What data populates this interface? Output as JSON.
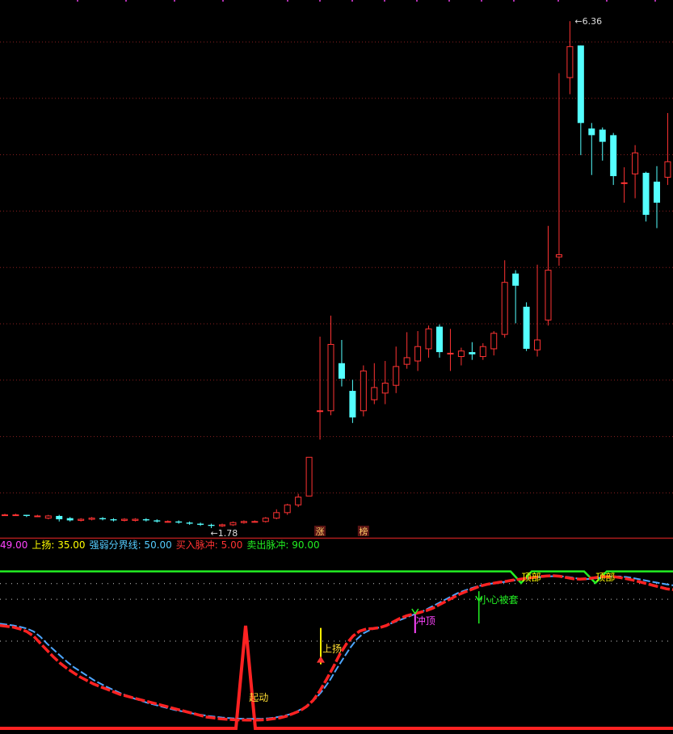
{
  "price_panel": {
    "high_label": "6.36",
    "low_label": "1.78",
    "markers": [
      {
        "text": "涨",
        "bar": 29
      },
      {
        "text": "榜",
        "bar": 33
      }
    ],
    "candles": [
      [
        1.9,
        1.9,
        1.91,
        1.89
      ],
      [
        1.9,
        1.9,
        1.91,
        1.89
      ],
      [
        1.9,
        1.89,
        1.9,
        1.88
      ],
      [
        1.89,
        1.89,
        1.9,
        1.88
      ],
      [
        1.87,
        1.89,
        1.9,
        1.86
      ],
      [
        1.89,
        1.86,
        1.9,
        1.84
      ],
      [
        1.87,
        1.85,
        1.88,
        1.84
      ],
      [
        1.85,
        1.86,
        1.87,
        1.84
      ],
      [
        1.86,
        1.87,
        1.88,
        1.85
      ],
      [
        1.87,
        1.86,
        1.88,
        1.85
      ],
      [
        1.86,
        1.85,
        1.87,
        1.84
      ],
      [
        1.85,
        1.86,
        1.87,
        1.84
      ],
      [
        1.85,
        1.86,
        1.87,
        1.84
      ],
      [
        1.86,
        1.85,
        1.87,
        1.84
      ],
      [
        1.85,
        1.84,
        1.86,
        1.83
      ],
      [
        1.84,
        1.84,
        1.85,
        1.83
      ],
      [
        1.84,
        1.83,
        1.85,
        1.82
      ],
      [
        1.83,
        1.82,
        1.84,
        1.81
      ],
      [
        1.82,
        1.81,
        1.83,
        1.8
      ],
      [
        1.81,
        1.8,
        1.82,
        1.78
      ],
      [
        1.8,
        1.81,
        1.82,
        1.79
      ],
      [
        1.81,
        1.83,
        1.84,
        1.8
      ],
      [
        1.83,
        1.84,
        1.85,
        1.82
      ],
      [
        1.84,
        1.84,
        1.85,
        1.83
      ],
      [
        1.84,
        1.87,
        1.88,
        1.83
      ],
      [
        1.87,
        1.92,
        1.95,
        1.86
      ],
      [
        1.92,
        1.99,
        2.0,
        1.9
      ],
      [
        1.99,
        2.06,
        2.09,
        1.97
      ],
      [
        2.07,
        2.42,
        2.42,
        2.07
      ],
      [
        2.84,
        2.84,
        3.51,
        2.58
      ],
      [
        2.84,
        3.44,
        3.7,
        2.8
      ],
      [
        3.27,
        3.13,
        3.48,
        3.06
      ],
      [
        3.02,
        2.78,
        3.12,
        2.73
      ],
      [
        2.84,
        3.2,
        3.25,
        2.79
      ],
      [
        2.94,
        3.05,
        3.27,
        2.9
      ],
      [
        3.0,
        3.09,
        3.29,
        2.9
      ],
      [
        3.07,
        3.24,
        3.42,
        3.0
      ],
      [
        3.26,
        3.32,
        3.55,
        3.22
      ],
      [
        3.29,
        3.42,
        3.56,
        3.2
      ],
      [
        3.4,
        3.58,
        3.61,
        3.32
      ],
      [
        3.6,
        3.37,
        3.62,
        3.32
      ],
      [
        3.36,
        3.36,
        3.58,
        3.2
      ],
      [
        3.33,
        3.38,
        3.41,
        3.25
      ],
      [
        3.37,
        3.35,
        3.46,
        3.3
      ],
      [
        3.33,
        3.42,
        3.45,
        3.3
      ],
      [
        3.4,
        3.54,
        3.56,
        3.34
      ],
      [
        3.53,
        4.0,
        4.2,
        3.5
      ],
      [
        4.08,
        3.97,
        4.11,
        3.63
      ],
      [
        3.78,
        3.4,
        3.82,
        3.38
      ],
      [
        3.39,
        3.48,
        4.16,
        3.33
      ],
      [
        3.66,
        4.11,
        4.51,
        3.61
      ],
      [
        4.23,
        4.25,
        5.89,
        4.15
      ],
      [
        5.85,
        6.13,
        6.36,
        5.7
      ],
      [
        6.14,
        5.44,
        6.14,
        5.15
      ],
      [
        5.39,
        5.33,
        5.44,
        4.97
      ],
      [
        5.38,
        5.27,
        5.4,
        5.1
      ],
      [
        5.33,
        4.96,
        5.35,
        4.88
      ],
      [
        4.9,
        4.9,
        5.04,
        4.72
      ],
      [
        4.98,
        5.17,
        5.24,
        4.76
      ],
      [
        4.99,
        4.61,
        5.0,
        4.55
      ],
      [
        4.91,
        4.72,
        5.05,
        4.49
      ],
      [
        4.95,
        5.09,
        5.53,
        4.88
      ]
    ]
  },
  "indicator_panel": {
    "legend": [
      {
        "text": "49.00",
        "color": "#ff44ff"
      },
      {
        "text": "上扬: 35.00",
        "color": "#ffff00"
      },
      {
        "text": "强弱分界线: 50.00",
        "color": "#55ccff"
      },
      {
        "text": "买入脉冲: 5.00",
        "color": "#ff3333"
      },
      {
        "text": "卖出脉冲: 90.00",
        "color": "#22ee22"
      }
    ],
    "ylim": [
      0,
      100
    ],
    "sell_line_value": 90,
    "dotted_lines": [
      50,
      74,
      83
    ],
    "red_line": [
      59,
      58.5,
      58,
      57,
      55.5,
      53,
      49,
      45,
      41,
      37.5,
      34.5,
      32,
      29.5,
      27.5,
      25.5,
      24,
      22.5,
      21,
      19.5,
      18.5,
      17.5,
      16.5,
      15.5,
      14.5,
      13.5,
      12.5,
      11.5,
      10.5,
      9.5,
      8.5,
      7.5,
      6.5,
      6,
      5.5,
      5.2,
      5,
      4.8,
      4.7,
      4.7,
      4.8,
      5,
      5.5,
      6,
      7,
      8.5,
      10,
      12.5,
      16,
      21.5,
      28,
      35,
      42.5,
      48.5,
      53,
      55.8,
      57,
      57.2,
      57.8,
      59,
      61,
      63,
      64.5,
      65.5,
      66.5,
      67.5,
      69,
      71,
      73,
      75,
      77,
      78.5,
      80,
      81.5,
      82.5,
      83.2,
      83.8,
      84.3,
      85,
      85.5,
      86,
      86.5,
      87,
      87.3,
      87.5,
      87.2,
      86.5,
      85.8,
      85.5,
      85.8,
      86.2,
      86.8,
      87,
      87,
      86.5,
      85.8,
      85,
      84,
      83,
      82,
      81,
      80,
      79.5
    ],
    "blue_line": [
      60,
      59.5,
      59,
      58.2,
      57.2,
      55.5,
      52.5,
      48.5,
      45,
      41.5,
      38,
      35,
      32.5,
      30,
      27.5,
      25.5,
      23.5,
      21.8,
      20,
      18.5,
      17,
      15.8,
      14.5,
      13.5,
      12.5,
      11.5,
      10.5,
      9.8,
      9,
      8.3,
      7.7,
      7.1,
      6.6,
      6.2,
      5.9,
      5.6,
      5.5,
      5.4,
      5.4,
      5.5,
      5.8,
      6.3,
      7,
      8,
      9.5,
      11.5,
      14,
      17.5,
      22,
      27.5,
      34,
      40,
      46,
      51,
      54.5,
      56.5,
      57.5,
      58.5,
      60,
      61.5,
      63,
      64.5,
      66,
      67.5,
      69.5,
      71.5,
      73.5,
      75.5,
      77.5,
      79,
      80.3,
      81.5,
      82.3,
      83,
      83.5,
      84,
      84.6,
      85.2,
      85.8,
      86.2,
      86.7,
      87,
      87.2,
      87.2,
      87,
      86.5,
      85.8,
      85.5,
      85.8,
      86.3,
      86.8,
      87,
      87.1,
      86.8,
      86.2,
      85.5,
      84.7,
      84,
      83.3,
      82.6,
      82
    ]
  },
  "annotations": [
    {
      "text": "起动",
      "color": "#ffdd33",
      "at": 0.37,
      "y": 18
    },
    {
      "text": "上扬",
      "color": "#ffdd33",
      "at": 0.479,
      "y": 46
    },
    {
      "text": "冲顶",
      "color": "#ff44ff",
      "at": 0.618,
      "y": 62
    },
    {
      "text": "小心被套",
      "color": "#22ee22",
      "at": 0.714,
      "y": 74
    },
    {
      "text": "顶部",
      "color": "#ffff00",
      "at": 0.775,
      "y": 87
    },
    {
      "text": "顶部",
      "color": "#ffff00",
      "at": 0.885,
      "y": 87
    }
  ],
  "colors": {
    "up": "#ff3333",
    "down": "#54ffff",
    "grid": "#8a1f1f",
    "divider": "#b01d1d",
    "sell": "#22ee22"
  }
}
